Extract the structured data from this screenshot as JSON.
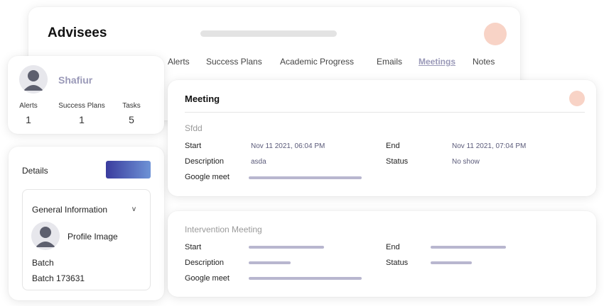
{
  "advisees": {
    "title": "Advisees",
    "tabs": [
      {
        "label": "Alerts"
      },
      {
        "label": "Success Plans"
      },
      {
        "label": "Academic Progress"
      },
      {
        "label": "Emails"
      },
      {
        "label": "Meetings",
        "active": true
      },
      {
        "label": "Notes"
      }
    ]
  },
  "profile": {
    "name": "Shafiur",
    "stats": [
      {
        "label": "Alerts",
        "value": "1"
      },
      {
        "label": "Success Plans",
        "value": "1"
      },
      {
        "label": "Tasks",
        "value": "5"
      }
    ]
  },
  "details": {
    "label": "Details",
    "general_information": "General Information",
    "chevron": "v",
    "profile_image_label": "Profile Image",
    "batch_label": "Batch",
    "batch_value": "Batch 173631"
  },
  "meeting": {
    "title": "Meeting",
    "name": "Sfdd",
    "start_label": "Start",
    "start_value": "Nov 11 2021, 06:04 PM",
    "end_label": "End",
    "end_value": "Nov 11 2021, 07:04 PM",
    "description_label": "Description",
    "description_value": "asda",
    "status_label": "Status",
    "status_value": "No show",
    "google_meet_label": "Google meet"
  },
  "intervention": {
    "name": "Intervention Meeting",
    "start_label": "Start",
    "end_label": "End",
    "description_label": "Description",
    "status_label": "Status",
    "google_meet_label": "Google meet"
  },
  "colors": {
    "accent_lavender": "#9a99b8",
    "avatar_peach": "#f8d3c6",
    "button_gradient_start": "#3a3c9e",
    "button_gradient_end": "#6e93d6"
  }
}
